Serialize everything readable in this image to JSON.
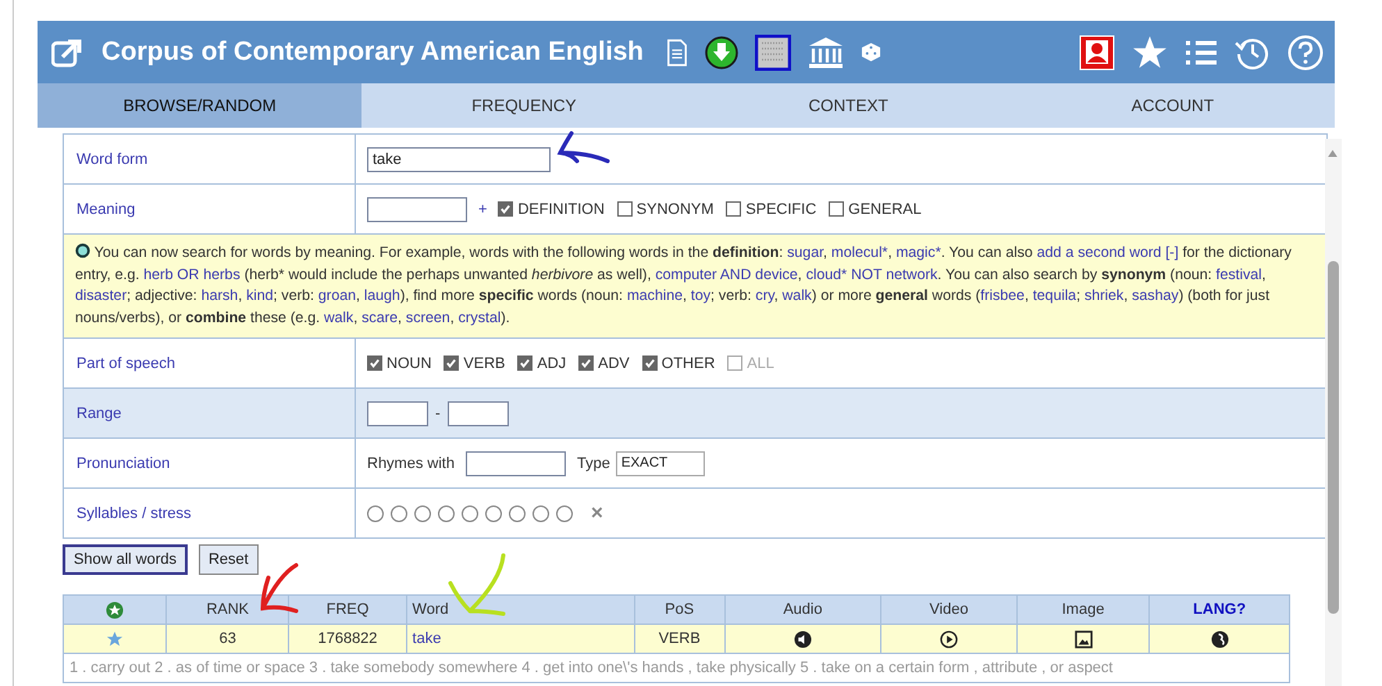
{
  "header": {
    "title": "Corpus of Contemporary American English"
  },
  "tabs": [
    {
      "label": "BROWSE/RANDOM",
      "selected": true
    },
    {
      "label": "FREQUENCY",
      "selected": false
    },
    {
      "label": "CONTEXT",
      "selected": false
    },
    {
      "label": "ACCOUNT",
      "selected": false
    }
  ],
  "form": {
    "word_form": {
      "label": "Word form",
      "value": "take"
    },
    "meaning": {
      "label": "Meaning",
      "plus": "+",
      "options": [
        {
          "label": "DEFINITION",
          "checked": true
        },
        {
          "label": "SYNONYM",
          "checked": false
        },
        {
          "label": "SPECIFIC",
          "checked": false
        },
        {
          "label": "GENERAL",
          "checked": false
        }
      ]
    },
    "info": [
      {
        "kind": "text",
        "text": "You can now search for words by meaning. For example, words with the following words in the "
      },
      {
        "kind": "bold",
        "text": "definition"
      },
      {
        "kind": "text",
        "text": ":  "
      },
      {
        "kind": "link",
        "text": "sugar"
      },
      {
        "kind": "text",
        "text": ", "
      },
      {
        "kind": "link",
        "text": "molecul*"
      },
      {
        "kind": "text",
        "text": ", "
      },
      {
        "kind": "link",
        "text": "magic*"
      },
      {
        "kind": "text",
        "text": ". You can also "
      },
      {
        "kind": "link",
        "text": "add a second word [-]"
      },
      {
        "kind": "text",
        "text": " for the dictionary entry, e.g. "
      },
      {
        "kind": "link",
        "text": "herb OR herbs"
      },
      {
        "kind": "text",
        "text": " (herb* would include the perhaps unwanted "
      },
      {
        "kind": "italic",
        "text": "herbivore"
      },
      {
        "kind": "text",
        "text": " as well), "
      },
      {
        "kind": "link",
        "text": "computer AND device"
      },
      {
        "kind": "text",
        "text": ", "
      },
      {
        "kind": "link",
        "text": "cloud* NOT network"
      },
      {
        "kind": "text",
        "text": ". You can also search by "
      },
      {
        "kind": "bold",
        "text": "synonym"
      },
      {
        "kind": "text",
        "text": " (noun: "
      },
      {
        "kind": "link",
        "text": "festival"
      },
      {
        "kind": "text",
        "text": ", "
      },
      {
        "kind": "link",
        "text": "disaster"
      },
      {
        "kind": "text",
        "text": "; adjective: "
      },
      {
        "kind": "link",
        "text": "harsh"
      },
      {
        "kind": "text",
        "text": ", "
      },
      {
        "kind": "link",
        "text": "kind"
      },
      {
        "kind": "text",
        "text": "; verb: "
      },
      {
        "kind": "link",
        "text": "groan"
      },
      {
        "kind": "text",
        "text": ", "
      },
      {
        "kind": "link",
        "text": "laugh"
      },
      {
        "kind": "text",
        "text": "), find more "
      },
      {
        "kind": "bold",
        "text": "specific"
      },
      {
        "kind": "text",
        "text": " words (noun: "
      },
      {
        "kind": "link",
        "text": "machine"
      },
      {
        "kind": "text",
        "text": ", "
      },
      {
        "kind": "link",
        "text": "toy"
      },
      {
        "kind": "text",
        "text": "; verb: "
      },
      {
        "kind": "link",
        "text": "cry"
      },
      {
        "kind": "text",
        "text": ", "
      },
      {
        "kind": "link",
        "text": "walk"
      },
      {
        "kind": "text",
        "text": ") or more "
      },
      {
        "kind": "bold",
        "text": "general"
      },
      {
        "kind": "text",
        "text": " words ("
      },
      {
        "kind": "link",
        "text": "frisbee"
      },
      {
        "kind": "text",
        "text": ", "
      },
      {
        "kind": "link",
        "text": "tequila"
      },
      {
        "kind": "text",
        "text": "; "
      },
      {
        "kind": "link",
        "text": "shriek"
      },
      {
        "kind": "text",
        "text": ", "
      },
      {
        "kind": "link",
        "text": "sashay"
      },
      {
        "kind": "text",
        "text": ") (both for just nouns/verbs), or "
      },
      {
        "kind": "bold",
        "text": "combine"
      },
      {
        "kind": "text",
        "text": " these (e.g. "
      },
      {
        "kind": "link",
        "text": "walk"
      },
      {
        "kind": "text",
        "text": ", "
      },
      {
        "kind": "link",
        "text": "scare"
      },
      {
        "kind": "text",
        "text": ", "
      },
      {
        "kind": "link",
        "text": "screen"
      },
      {
        "kind": "text",
        "text": ", "
      },
      {
        "kind": "link",
        "text": "crystal"
      },
      {
        "kind": "text",
        "text": ")."
      }
    ],
    "part_of_speech": {
      "label": "Part of speech",
      "options": [
        {
          "label": "NOUN",
          "checked": true,
          "disabled": false
        },
        {
          "label": "VERB",
          "checked": true,
          "disabled": false
        },
        {
          "label": "ADJ",
          "checked": true,
          "disabled": false
        },
        {
          "label": "ADV",
          "checked": true,
          "disabled": false
        },
        {
          "label": "OTHER",
          "checked": true,
          "disabled": false
        },
        {
          "label": "ALL",
          "checked": false,
          "disabled": true
        }
      ]
    },
    "range": {
      "label": "Range",
      "separator": "-"
    },
    "pronunciation": {
      "label": "Pronunciation",
      "rhymes_label": "Rhymes with",
      "type_label": "Type",
      "type_value": "EXACT"
    },
    "syllables": {
      "label": "Syllables / stress",
      "clear": "×"
    }
  },
  "buttons": [
    {
      "label": "Show all words",
      "selected": true
    },
    {
      "label": "Reset",
      "selected": false
    }
  ],
  "table": {
    "columns": [
      "RANK",
      "FREQ",
      "Word",
      "PoS",
      "Audio",
      "Video",
      "Image",
      "LANG?"
    ],
    "rows": [
      {
        "rank": "63",
        "freq": "1768822",
        "word": "take",
        "pos": "VERB"
      }
    ],
    "definition": "1 . carry out 2 . as of time or space 3 . take somebody somewhere 4 . get into one\\'s hands , take physically 5 . take on a certain form , attribute , or aspect"
  }
}
